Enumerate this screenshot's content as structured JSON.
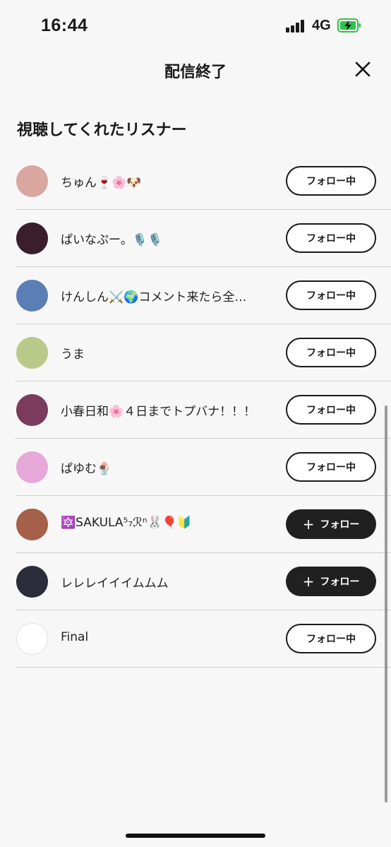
{
  "status_bar": {
    "time": "16:44",
    "network": "4G",
    "battery_color": "#32c24a"
  },
  "header": {
    "title": "配信終了",
    "close_icon": "close-icon"
  },
  "section": {
    "title": "視聴してくれたリスナー"
  },
  "listeners": [
    {
      "name": "ちゅん🍷🌸🐶",
      "button": "フォロー中",
      "state": "following",
      "avatar_color": "#d9a7a0"
    },
    {
      "name": "ぱいなぷー。🎙️🎙️",
      "button": "フォロー中",
      "state": "following",
      "avatar_color": "#3a1f2a"
    },
    {
      "name": "けんしん⚔️🌍コメント来たら全…",
      "button": "フォロー中",
      "state": "following",
      "avatar_color": "#5b7fb5"
    },
    {
      "name": "うま",
      "button": "フォロー中",
      "state": "following",
      "avatar_color": "#b9c98a"
    },
    {
      "name": "小春日和🌸４日までトプバナ！！！",
      "button": "フォロー中",
      "state": "following",
      "avatar_color": "#7a3b5c"
    },
    {
      "name": "ぱゆむ🍨",
      "button": "フォロー中",
      "state": "following",
      "avatar_color": "#e6a8d8"
    },
    {
      "name": "🔯SAKULA⁵₇ℛⁿ🐰🎈🔰",
      "button": "フォロー",
      "state": "follow",
      "avatar_color": "#a5604a"
    },
    {
      "name": "レレレイイイムムム",
      "button": "フォロー",
      "state": "follow",
      "avatar_color": "#2b2e3a"
    },
    {
      "name": "Final",
      "button": "フォロー中",
      "state": "following",
      "avatar_color": "#ffffff"
    }
  ]
}
